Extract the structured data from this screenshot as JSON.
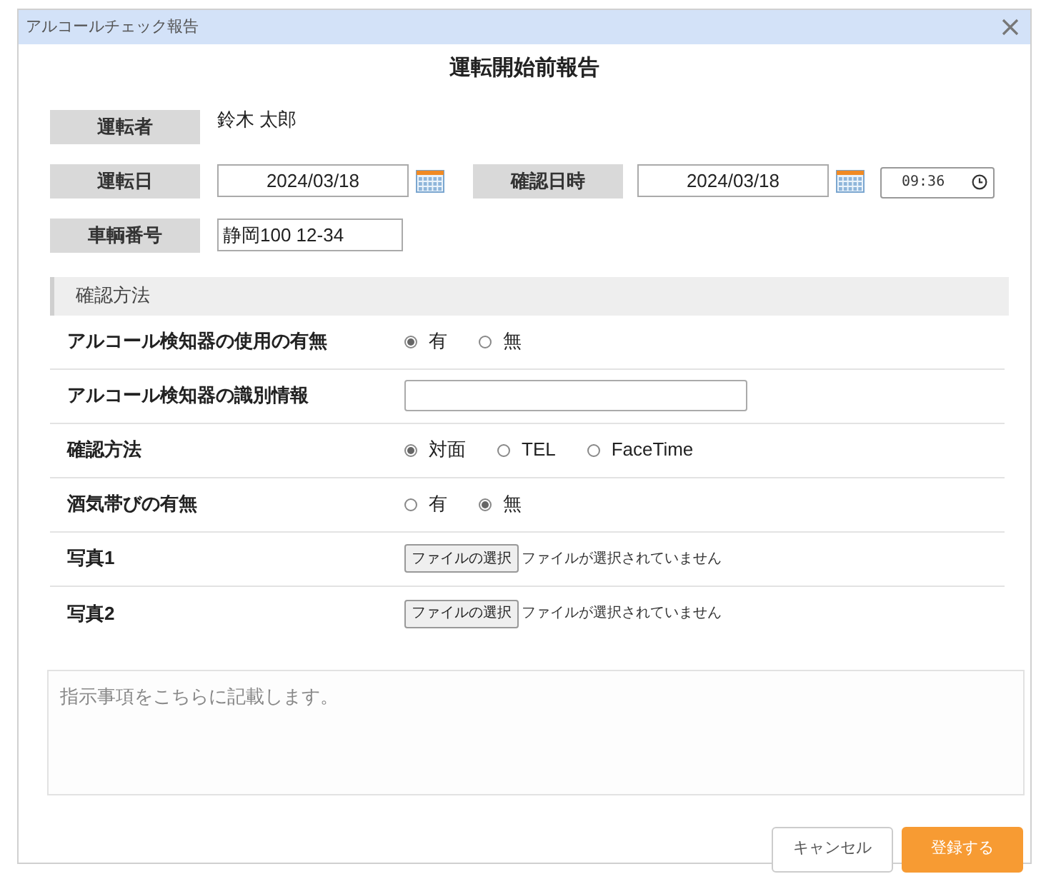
{
  "window": {
    "title": "アルコールチェック報告"
  },
  "heading": "運転開始前報告",
  "driver": {
    "label": "運転者",
    "value": "鈴木 太郎"
  },
  "drive_date": {
    "label": "運転日",
    "value": "2024/03/18"
  },
  "check_datetime": {
    "label": "確認日時",
    "date": "2024/03/18",
    "time": "09:36"
  },
  "vehicle": {
    "label": "車輌番号",
    "value": "静岡100 12-34"
  },
  "section": {
    "title": "確認方法",
    "rows": [
      {
        "kind": "radio",
        "label": "アルコール検知器の使用の有無",
        "options": [
          {
            "label": "有",
            "selected": true
          },
          {
            "label": "無",
            "selected": false
          }
        ]
      },
      {
        "kind": "text",
        "label": "アルコール検知器の識別情報"
      },
      {
        "kind": "radio",
        "label": "確認方法",
        "options": [
          {
            "label": "対面",
            "selected": true
          },
          {
            "label": "TEL",
            "selected": false
          },
          {
            "label": "FaceTime",
            "selected": false
          }
        ]
      },
      {
        "kind": "radio",
        "label": "酒気帯びの有無",
        "options": [
          {
            "label": "有",
            "selected": false
          },
          {
            "label": "無",
            "selected": true
          }
        ]
      },
      {
        "kind": "file",
        "label": "写真1",
        "button": "ファイルの選択",
        "status": "ファイルが選択されていません"
      },
      {
        "kind": "file",
        "label": "写真2",
        "button": "ファイルの選択",
        "status": "ファイルが選択されていません"
      }
    ]
  },
  "notes": {
    "placeholder": "指示事項をこちらに記載します。"
  },
  "buttons": [
    {
      "label": "キャンセル",
      "kind": "secondary"
    },
    {
      "label": "登録する",
      "kind": "primary"
    }
  ]
}
